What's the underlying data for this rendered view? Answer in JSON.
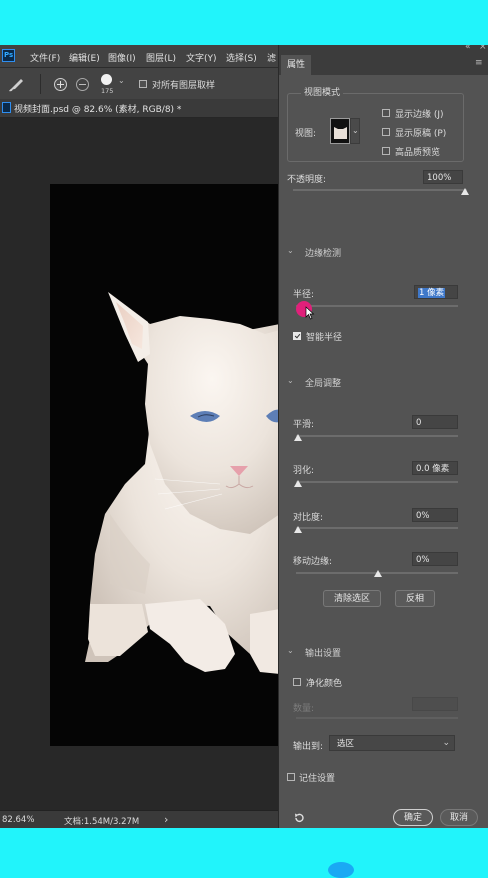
{
  "menubar": {
    "logo": "Ps",
    "items": [
      "文件(F)",
      "编辑(E)",
      "图像(I)",
      "图层(L)",
      "文字(Y)",
      "选择(S)",
      "滤"
    ]
  },
  "toolbar": {
    "brush_size": "175",
    "sample_all_layers_label": "对所有图层取样"
  },
  "document": {
    "tab_title": "视频封面.psd @ 82.6% (素材, RGB/8) *"
  },
  "status": {
    "zoom": "82.64%",
    "doc_info": "文档:1.54M/3.27M",
    "arrow": "›"
  },
  "panel": {
    "collapse_glyph": "«",
    "tab_label": "属性",
    "view_mode": {
      "title": "视图模式",
      "view_label": "视图:",
      "show_edge": "显示边缘 (J)",
      "show_original": "显示原稿 (P)",
      "hq_preview": "高品质预览"
    },
    "opacity": {
      "label": "不透明度:",
      "value": "100%"
    },
    "edge_detection": {
      "title": "边缘检测",
      "radius_label": "半径:",
      "radius_value": "1 像素",
      "smart_radius_label": "智能半径"
    },
    "global_refine": {
      "title": "全局调整",
      "smooth_label": "平滑:",
      "smooth_value": "0",
      "feather_label": "羽化:",
      "feather_value": "0.0 像素",
      "contrast_label": "对比度:",
      "contrast_value": "0%",
      "shift_edge_label": "移动边缘:",
      "shift_edge_value": "0%",
      "clear_selection_button": "清除选区",
      "invert_button": "反相"
    },
    "output": {
      "title": "输出设置",
      "decontaminate_label": "净化颜色",
      "amount_label": "数量:",
      "output_to_label": "输出到:",
      "output_to_value": "选区"
    },
    "remember_label": "记住设置",
    "ok_button": "确定",
    "cancel_button": "取消"
  },
  "colors": {
    "panel_bg": "#535353",
    "canvas_bg": "#282828",
    "frame_bg": "#21f4fb",
    "highlight": "#3f78c9",
    "cursor_dot": "#e0207a"
  }
}
